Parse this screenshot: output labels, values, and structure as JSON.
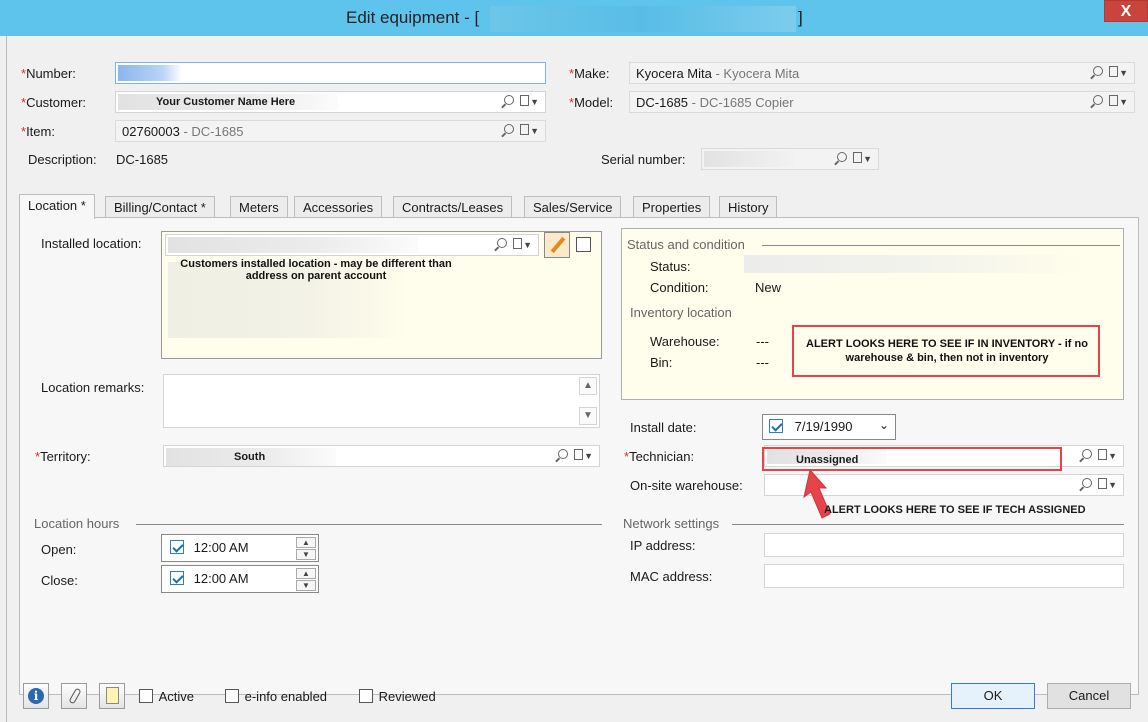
{
  "window": {
    "title": "Edit equipment - [",
    "title_suffix": "]",
    "close_label": "X"
  },
  "header": {
    "number_label": "Number:",
    "number_value": "",
    "make_label": "Make:",
    "make_value": "Kyocera Mita",
    "make_sub": " - Kyocera Mita",
    "customer_label": "Customer:",
    "customer_value": "Your Customer Name Here",
    "model_label": "Model:",
    "model_value": "DC-1685",
    "model_sub": " - DC-1685 Copier",
    "item_label": "Item:",
    "item_value": "02760003",
    "item_sub": " - DC-1685",
    "description_label": "Description:",
    "description_value": "DC-1685",
    "serial_label": "Serial number:",
    "serial_value": ""
  },
  "tabs": [
    {
      "label": "Location *"
    },
    {
      "label": "Billing/Contact *"
    },
    {
      "label": "Meters"
    },
    {
      "label": "Accessories"
    },
    {
      "label": "Contracts/Leases"
    },
    {
      "label": "Sales/Service"
    },
    {
      "label": "Properties"
    },
    {
      "label": "History"
    }
  ],
  "location": {
    "installed_location_label": "Installed location:",
    "installed_location_note": "Customers installed location - may be different than address on parent account",
    "location_remarks_label": "Location remarks:",
    "territory_label": "Territory:",
    "territory_value": "South",
    "hours_section": "Location hours",
    "open_label": "Open:",
    "open_value": "12:00 AM",
    "close_label": "Close:",
    "close_value": "12:00 AM"
  },
  "status": {
    "section": "Status and condition",
    "status_label": "Status:",
    "status_value": "",
    "condition_label": "Condition:",
    "condition_value": "New",
    "inventory_section": "Inventory location",
    "warehouse_label": "Warehouse:",
    "warehouse_value": "---",
    "bin_label": "Bin:",
    "bin_value": "---",
    "inventory_alert": "ALERT LOOKS HERE TO SEE IF IN INVENTORY - if no warehouse & bin, then not in inventory"
  },
  "install": {
    "install_date_label": "Install date:",
    "install_date_value": "7/19/1990",
    "technician_label": "Technician:",
    "technician_value": "Unassigned",
    "onsite_label": "On-site warehouse:",
    "tech_alert": "ALERT LOOKS HERE TO SEE IF TECH ASSIGNED"
  },
  "network": {
    "section": "Network settings",
    "ip_label": "IP address:",
    "ip_value": "",
    "mac_label": "MAC address:",
    "mac_value": ""
  },
  "footer": {
    "active_label": "Active",
    "einfo_label": "e-info enabled",
    "reviewed_label": "Reviewed",
    "ok_label": "OK",
    "cancel_label": "Cancel"
  },
  "colors": {
    "titlebar": "#5fc4ec",
    "required": "#d0312d",
    "alert_red": "#e6434b",
    "panel_yellow": "#fffdeb"
  }
}
